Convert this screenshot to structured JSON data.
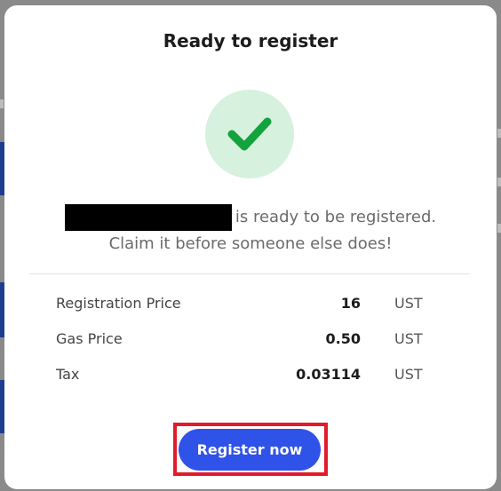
{
  "modal": {
    "title": "Ready to register",
    "message_line1": "is ready to be registered.",
    "message_line2": "Claim it before someone else does!",
    "success_icon": "check-icon"
  },
  "prices": [
    {
      "label": "Registration Price",
      "value": "16",
      "unit": "UST"
    },
    {
      "label": "Gas Price",
      "value": "0.50",
      "unit": "UST"
    },
    {
      "label": "Tax",
      "value": "0.03114",
      "unit": "UST"
    }
  ],
  "actions": {
    "register_label": "Register now"
  },
  "colors": {
    "accent": "#2f52e8",
    "success": "#12a33d",
    "success_bg": "#d6f1dd",
    "highlight": "#e21b2b"
  }
}
